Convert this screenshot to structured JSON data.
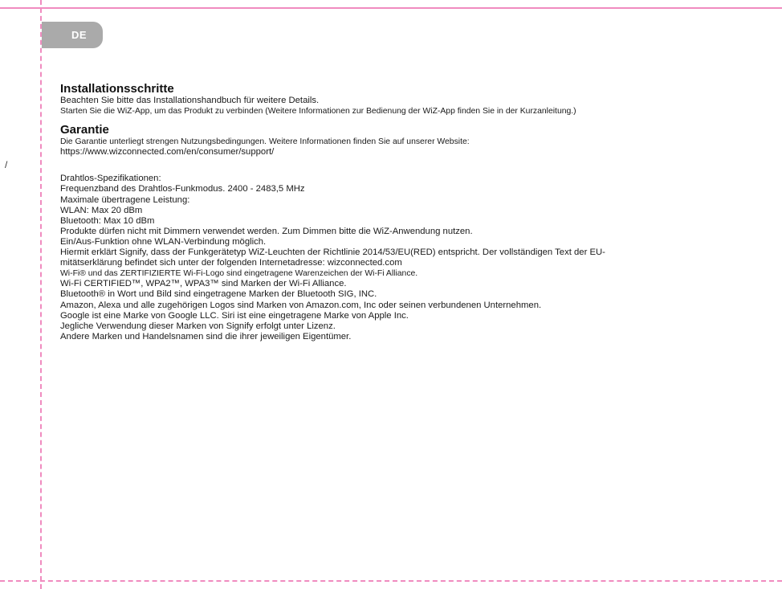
{
  "language_tab": "DE",
  "stray_mark": "/",
  "installation": {
    "heading": "Installationsschritte",
    "lines": [
      "Beachten Sie bitte das Installationshandbuch für weitere Details.",
      "Starten Sie die WiZ-App, um das Produkt zu verbinden (Weitere Informationen zur Bedienung der WiZ-App finden Sie in der Kurzanleitung.)"
    ]
  },
  "warranty": {
    "heading": "Garantie",
    "lines": [
      "Die Garantie unterliegt strengen Nutzungsbedingungen. Weitere Informationen finden Sie auf unserer Website:",
      "https://www.wizconnected.com/en/consumer/support/"
    ]
  },
  "specs": {
    "lines": [
      "Drahtlos-Spezifikationen:",
      "Frequenzband des Drahtlos-Funkmodus. 2400 - 2483,5 MHz",
      "Maximale übertragene Leistung:",
      "WLAN: Max 20 dBm",
      "Bluetooth: Max 10 dBm",
      "Produkte dürfen nicht mit Dimmern verwendet werden. Zum Dimmen bitte die WiZ-Anwendung nutzen.",
      "Ein/Aus-Funktion ohne WLAN-Verbindung möglich.",
      "Hiermit erklärt Signify, dass der Funkgerätetyp WiZ-Leuchten der Richtlinie 2014/53/EU(RED) entspricht. Der vollständigen Text der EU-",
      "mitätserklärung befindet sich unter der folgenden Internetadresse: wizconnected.com",
      "Wi-Fi® und das ZERTIFIZIERTE Wi-Fi-Logo sind eingetragene Warenzeichen der Wi-Fi Alliance.",
      "Wi-Fi CERTIFIED™, WPA2™, WPA3™ sind Marken der Wi-Fi Alliance.",
      "Bluetooth® in Wort und Bild sind eingetragene Marken der Bluetooth SIG, INC.",
      "Amazon, Alexa und alle zugehörigen Logos sind Marken von Amazon.com, Inc oder seinen verbundenen Unternehmen.",
      "Google ist eine Marke von Google LLC. Siri ist eine eingetragene Marke von Apple Inc.",
      "Jegliche Verwendung dieser Marken von Signify erfolgt unter Lizenz.",
      "Andere Marken und Handelsnamen sind die ihrer jeweiligen Eigentümer."
    ]
  },
  "colors": {
    "guide_pink": "#f08cc0",
    "tab_gray": "#aaaaaa"
  }
}
